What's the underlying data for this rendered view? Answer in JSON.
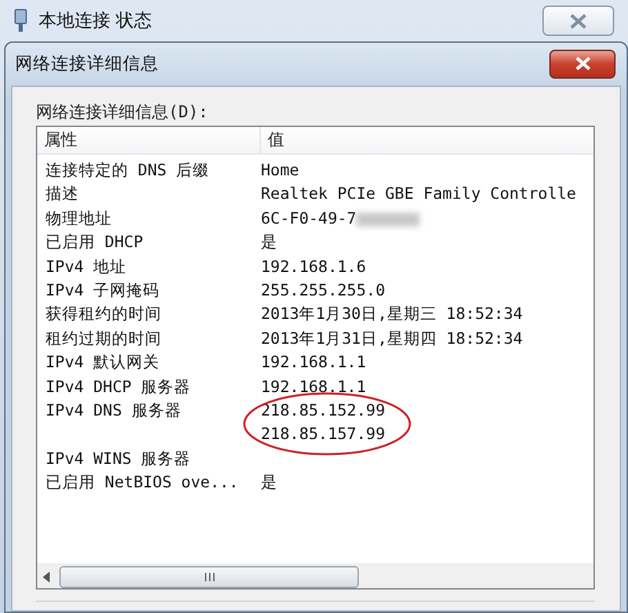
{
  "back_window": {
    "title": "本地连接 状态"
  },
  "dialog": {
    "title": "网络连接详细信息",
    "list_label": "网络连接详细信息(D):",
    "columns": [
      "属性",
      "值"
    ],
    "rows": [
      {
        "property": "连接特定的 DNS 后缀",
        "values": [
          "Home"
        ],
        "circled": false
      },
      {
        "property": "描述",
        "values": [
          "Realtek PCIe GBE Family Controlle"
        ],
        "circled": false
      },
      {
        "property": "物理地址",
        "values": [
          "6C-F0-49-7"
        ],
        "redacted": true,
        "circled": false
      },
      {
        "property": "已启用 DHCP",
        "values": [
          "是"
        ],
        "circled": false
      },
      {
        "property": "IPv4 地址",
        "values": [
          "192.168.1.6"
        ],
        "circled": false
      },
      {
        "property": "IPv4 子网掩码",
        "values": [
          "255.255.255.0"
        ],
        "circled": false
      },
      {
        "property": "获得租约的时间",
        "values": [
          "2013年1月30日,星期三 18:52:34"
        ],
        "circled": false
      },
      {
        "property": "租约过期的时间",
        "values": [
          "2013年1月31日,星期四 18:52:34"
        ],
        "circled": false
      },
      {
        "property": "IPv4 默认网关",
        "values": [
          "192.168.1.1"
        ],
        "circled": false
      },
      {
        "property": "IPv4 DHCP 服务器",
        "values": [
          "192.168.1.1"
        ],
        "circled": false
      },
      {
        "property": "IPv4 DNS 服务器",
        "values": [
          "218.85.152.99",
          "218.85.157.99"
        ],
        "circled": true
      },
      {
        "property": "IPv4 WINS 服务器",
        "values": [],
        "circled": false
      },
      {
        "property": "已启用 NetBIOS ove...",
        "values": [
          "是"
        ],
        "circled": false
      }
    ]
  }
}
